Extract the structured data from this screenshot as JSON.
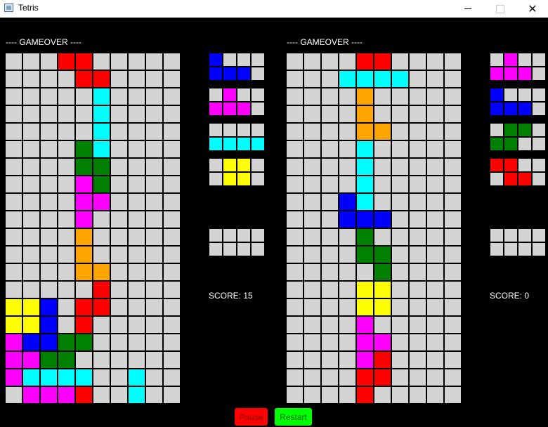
{
  "window": {
    "title": "Tetris",
    "icon": "app-window-icon",
    "minimize_icon": "minimize-icon",
    "maximize_icon": "maximize-icon",
    "close_icon": "close-icon",
    "close_label": "✕"
  },
  "colors": {
    ".": "#d4d4d4",
    "R": "#ff0000",
    "C": "#00ffff",
    "G": "#008000",
    "M": "#ff00ff",
    "O": "#ffa500",
    "Y": "#ffff00",
    "B": "#0000ff"
  },
  "players": [
    {
      "status": "---- GAMEOVER ----",
      "score_label": "SCORE: 15",
      "board": [
        "...RR.....",
        "....RR....",
        ".....C....",
        ".....C....",
        ".....C....",
        "....GC....",
        "....GG....",
        "....MG....",
        "....MM....",
        "....M.....",
        "....O.....",
        "....O.....",
        "....OO....",
        ".....R....",
        "YYB.RR....",
        "YYB.R.....",
        "MBBGG.....",
        "MMGG......",
        "MCCCC..C..",
        ".MMMR..C.."
      ],
      "next_pieces": [
        [
          "B...",
          "BBB."
        ],
        [
          ".M..",
          "MMM."
        ],
        [
          "....",
          "CCCC"
        ],
        [
          ".YY.",
          ".YY."
        ],
        [
          "....",
          "...."
        ]
      ]
    },
    {
      "status": "---- GAMEOVER ----",
      "score_label": "SCORE: 0",
      "board": [
        "....RR....",
        "...CCCC...",
        "....O.....",
        "....O.....",
        "....OO....",
        "....C.....",
        "....C.....",
        "....C.....",
        "...BC.....",
        "...BBB....",
        "....G.....",
        "....GG....",
        ".....G....",
        "....YY....",
        "....YY....",
        "....M.....",
        "....MM....",
        "....MR....",
        "....RR....",
        "....R....."
      ],
      "next_pieces": [
        [
          ".M..",
          "MMM."
        ],
        [
          "B...",
          "BBB."
        ],
        [
          ".GG.",
          "GG.."
        ],
        [
          "RR..",
          ".RR."
        ],
        [
          "....",
          "...."
        ]
      ]
    }
  ],
  "controls": {
    "pause_label": "Pause",
    "restart_label": "Restart",
    "pause_color": "#ff0000",
    "restart_color": "#00ff00",
    "pause_text_color": "#8b0000",
    "restart_text_color": "#006400"
  }
}
